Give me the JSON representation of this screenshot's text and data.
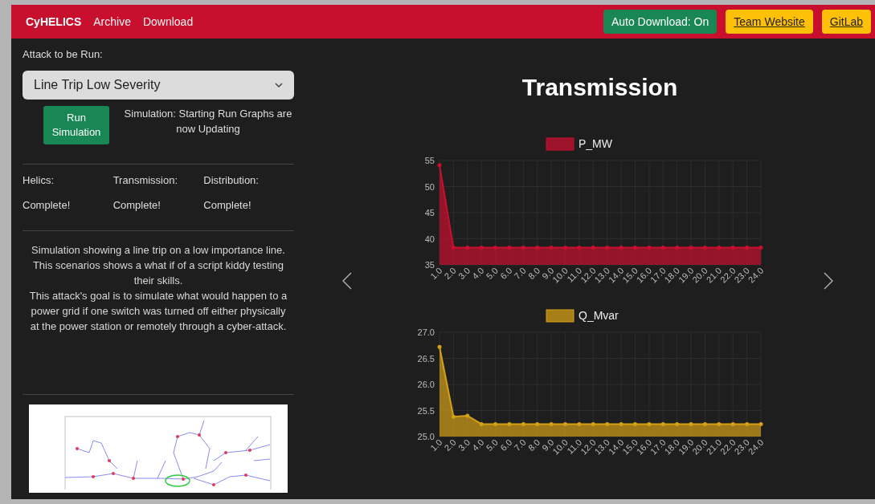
{
  "navbar": {
    "brand": "CyHELICS",
    "links": [
      "Archive",
      "Download"
    ],
    "buttons": [
      {
        "label": "Auto Download: On",
        "kind": "status"
      },
      {
        "label": "Team Website",
        "kind": "link"
      },
      {
        "label": "GitLab",
        "kind": "link"
      }
    ]
  },
  "sidebar": {
    "attack_label": "Attack to be Run:",
    "attack_select": {
      "value": "Line Trip Low Severity"
    },
    "run_button": "Run Simulation",
    "run_status": "Simulation: Starting Run Graphs are now Updating",
    "statuses": [
      {
        "name": "Helics:",
        "value": "Complete!"
      },
      {
        "name": "Transmission:",
        "value": "Complete!"
      },
      {
        "name": "Distribution:",
        "value": "Complete!"
      }
    ],
    "description": [
      "Simulation showing a line trip on a low importance line. This scenarios shows a what if of a script kiddy testing their skills.",
      "This attack's goal is to simulate what would happen to a power grid if one switch was turned off either physically at the power station or remotely through a cyber-attack."
    ]
  },
  "carousel": {
    "title": "Transmission",
    "charts": [
      {
        "chart_data": {
          "type": "area",
          "grid": true,
          "categories": [
            "1.0",
            "2.0",
            "3.0",
            "4.0",
            "5.0",
            "6.0",
            "7.0",
            "8.0",
            "9.0",
            "10.0",
            "11.0",
            "12.0",
            "13.0",
            "14.0",
            "15.0",
            "16.0",
            "17.0",
            "18.0",
            "19.0",
            "20.0",
            "21.0",
            "22.0",
            "23.0",
            "24.0"
          ],
          "ylim": [
            35,
            55
          ],
          "yticks": [
            35,
            40,
            45,
            50,
            55
          ],
          "series": [
            {
              "name": "P_MW",
              "color": "#c8102e",
              "values": [
                54.1,
                38.3,
                38.3,
                38.3,
                38.3,
                38.3,
                38.3,
                38.3,
                38.3,
                38.3,
                38.3,
                38.3,
                38.3,
                38.3,
                38.3,
                38.3,
                38.3,
                38.3,
                38.3,
                38.3,
                38.3,
                38.3,
                38.3,
                38.3
              ]
            }
          ]
        }
      },
      {
        "chart_data": {
          "type": "area",
          "grid": true,
          "categories": [
            "1.0",
            "2.0",
            "3.0",
            "4.0",
            "5.0",
            "6.0",
            "7.0",
            "8.0",
            "9.0",
            "10.0",
            "11.0",
            "12.0",
            "13.0",
            "14.0",
            "15.0",
            "16.0",
            "17.0",
            "18.0",
            "19.0",
            "20.0",
            "21.0",
            "22.0",
            "23.0",
            "24.0"
          ],
          "ylim": [
            25,
            27
          ],
          "yticks": [
            {
              "value": 25,
              "label": "25.0"
            },
            {
              "value": 25.5,
              "label": "25.5"
            },
            {
              "value": 26,
              "label": "26.0"
            },
            {
              "value": 26.5,
              "label": "26.5"
            },
            {
              "value": 27,
              "label": "27.0"
            }
          ],
          "series": [
            {
              "name": "Q_Mvar",
              "color": "#d4a017",
              "values": [
                26.72,
                25.38,
                25.4,
                25.24,
                25.24,
                25.24,
                25.24,
                25.24,
                25.24,
                25.24,
                25.24,
                25.24,
                25.24,
                25.24,
                25.24,
                25.24,
                25.24,
                25.24,
                25.24,
                25.24,
                25.24,
                25.24,
                25.24,
                25.24
              ]
            }
          ]
        }
      }
    ]
  }
}
